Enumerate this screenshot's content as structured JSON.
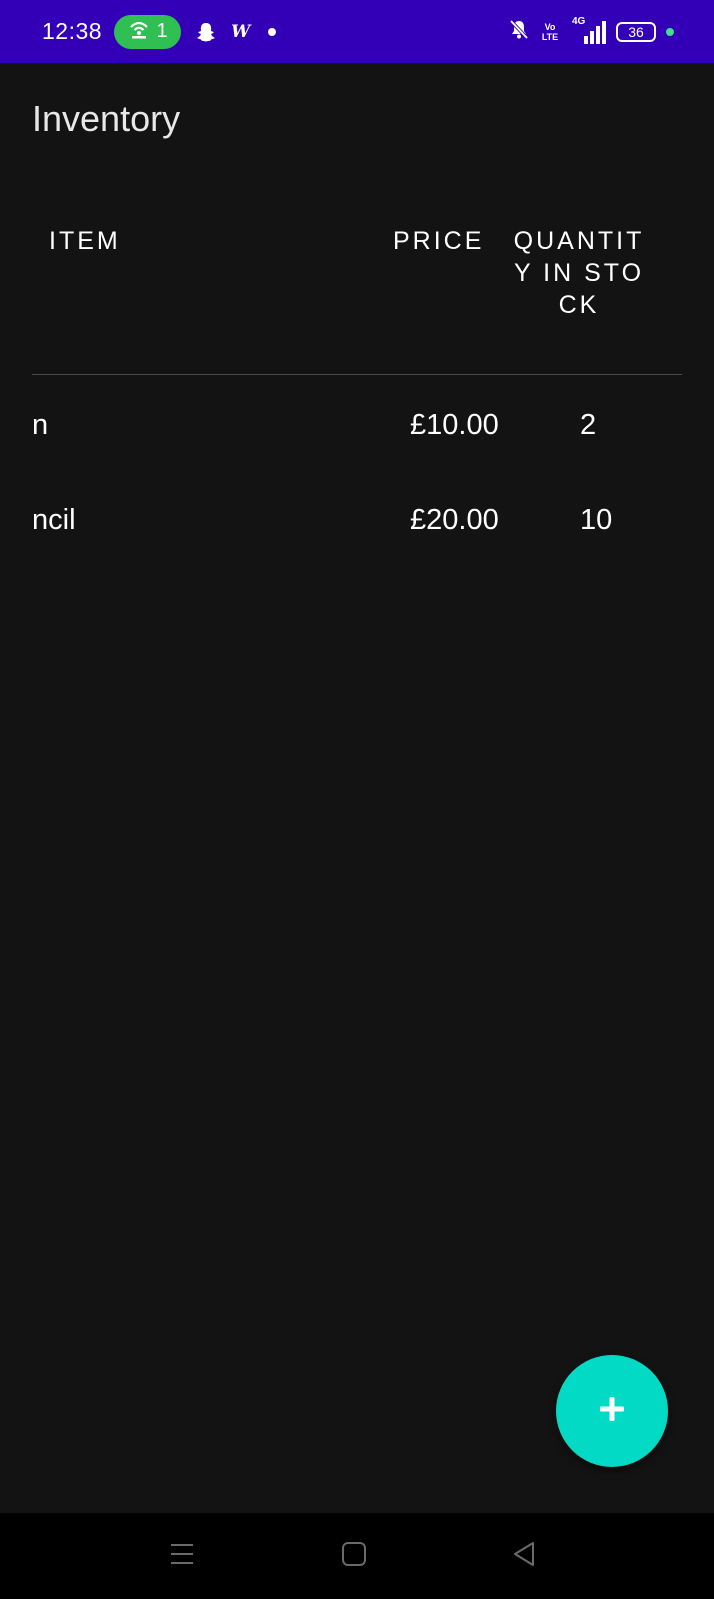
{
  "status_bar": {
    "time": "12:38",
    "hotspot_count": "1",
    "battery_level": "36",
    "w_label": "W",
    "volte_top": "Vo",
    "volte_bottom": "LTE",
    "network_type": "4G",
    "bar_color": "#3300b8",
    "hotspot_color": "#2fbf53"
  },
  "app": {
    "title": "Inventory",
    "accent": "#03dac5",
    "background": "#131313"
  },
  "table": {
    "headers": {
      "item": "ITEM",
      "price": "PRICE",
      "quantity": "QUANTITY IN STOCK"
    },
    "rows": [
      {
        "item": "n",
        "price": "£10.00",
        "quantity": "2"
      },
      {
        "item": "ncil",
        "price": "£20.00",
        "quantity": "10"
      }
    ]
  },
  "fab": {
    "icon": "plus-icon"
  },
  "nav_bar": {
    "icons": [
      "menu-icon",
      "home-icon",
      "back-icon"
    ]
  }
}
